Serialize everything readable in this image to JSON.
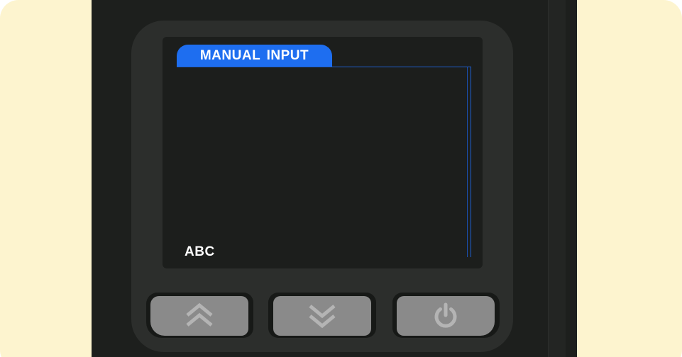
{
  "screen": {
    "tab_label": "MANUAL  INPUT",
    "input_value": "ABC"
  },
  "buttons": [
    {
      "id": "up",
      "icon": "double-chevron-up-icon"
    },
    {
      "id": "down",
      "icon": "double-chevron-down-icon"
    },
    {
      "id": "power",
      "icon": "power-icon"
    }
  ],
  "colors": {
    "background": "#fdf4cf",
    "device_body": "#1d1f1d",
    "bezel": "#2c2e2c",
    "screen": "#1c1e1c",
    "accent": "#1e6ef0",
    "button": "#8a8a8a",
    "button_icon": "#b4b4b4"
  }
}
